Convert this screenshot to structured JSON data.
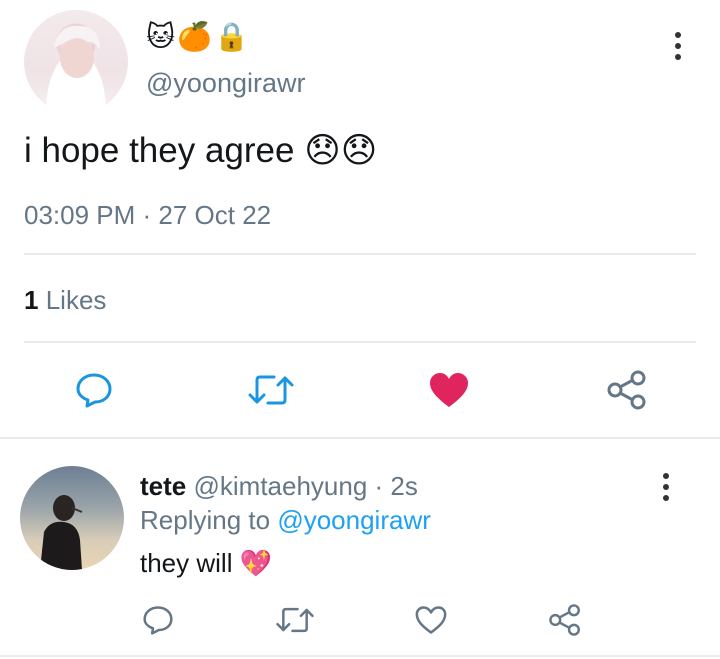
{
  "tweet": {
    "name_emojis": [
      "🐱",
      "🍊",
      "🔒"
    ],
    "handle": "@yoongirawr",
    "text": "i hope they agree",
    "text_emojis": "😞😞",
    "timestamp": "03:09 PM · 27 Oct 22",
    "likes_count": "1",
    "likes_label": "Likes",
    "liked": true
  },
  "reply": {
    "display_name": "tete",
    "handle": "@kimtaehyung",
    "time": "· 2s",
    "replying_prefix": "Replying to",
    "replying_handle": "@yoongirawr",
    "text": "they will",
    "text_emoji": "💖"
  },
  "colors": {
    "like_red": "#e0245e",
    "link_blue": "#1da1f2",
    "muted": "#657786",
    "icon_gray": "#657786",
    "action_blue": "#1b95e0"
  }
}
